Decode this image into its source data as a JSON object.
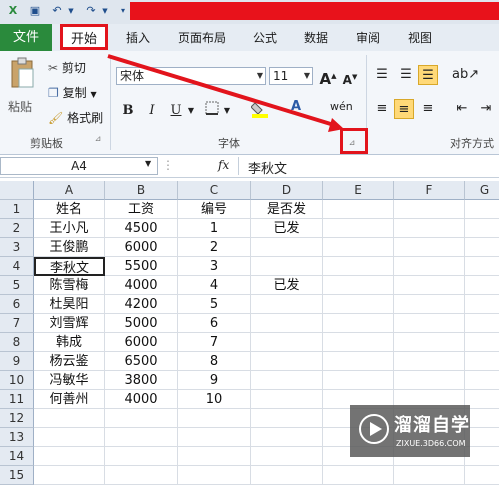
{
  "quick_access": {
    "save_icon": "save-icon",
    "undo_icon": "undo-icon",
    "redo_icon": "redo-icon"
  },
  "tabs": [
    "文件",
    "开始",
    "插入",
    "页面布局",
    "公式",
    "数据",
    "审阅",
    "视图"
  ],
  "clipboard": {
    "paste": "粘贴",
    "cut": "剪切",
    "copy": "复制",
    "format_painter": "格式刷",
    "group_label": "剪贴板"
  },
  "font": {
    "name": "宋体",
    "size": "11",
    "bold": "B",
    "italic": "I",
    "underline": "U",
    "group_label": "字体",
    "grow": "A",
    "shrink": "A",
    "wen": "wén"
  },
  "alignment": {
    "group_label": "对齐方式"
  },
  "formula_bar": {
    "cell_ref": "A4",
    "fx": "fx",
    "value": "李秋文"
  },
  "columns": [
    "A",
    "B",
    "C",
    "D",
    "E",
    "F",
    "G"
  ],
  "rows": [
    "1",
    "2",
    "3",
    "4",
    "5",
    "6",
    "7",
    "8",
    "9",
    "10",
    "11",
    "12",
    "13",
    "14",
    "15"
  ],
  "cells": [
    [
      "姓名",
      "工资",
      "编号",
      "是否发"
    ],
    [
      "王小凡",
      "4500",
      "1",
      "已发"
    ],
    [
      "王俊鹏",
      "6000",
      "2",
      ""
    ],
    [
      "李秋文",
      "5500",
      "3",
      ""
    ],
    [
      "陈雪梅",
      "4000",
      "4",
      "已发"
    ],
    [
      "杜昊阳",
      "4200",
      "5",
      ""
    ],
    [
      "刘雪辉",
      "5000",
      "6",
      ""
    ],
    [
      "韩成",
      "6000",
      "7",
      ""
    ],
    [
      "杨云鉴",
      "6500",
      "8",
      ""
    ],
    [
      "冯敏华",
      "3800",
      "9",
      ""
    ],
    [
      "何善州",
      "4000",
      "10",
      ""
    ]
  ],
  "watermark": {
    "title": "溜溜自学",
    "sub": "ZIXUE.3D66.COM"
  },
  "colors": {
    "file_tab": "#2a8a3c",
    "highlight_red": "#e2141c",
    "title_red": "#e8121b"
  }
}
